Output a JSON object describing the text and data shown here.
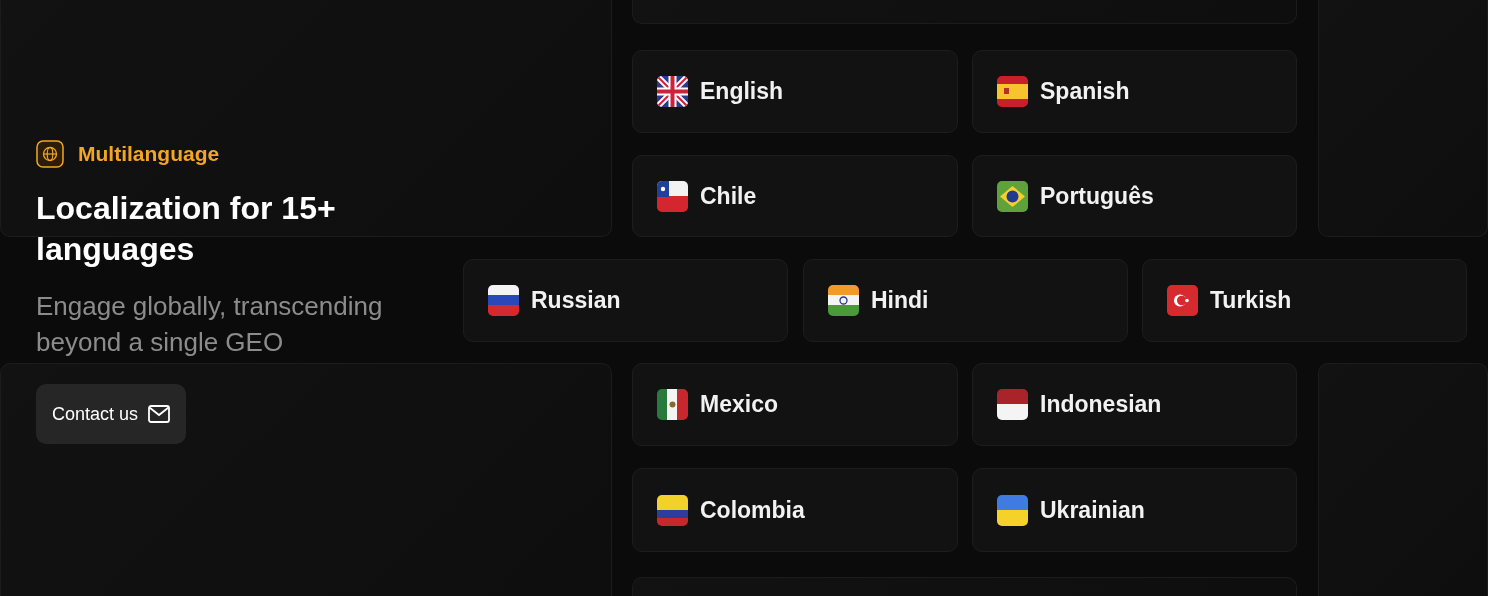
{
  "feature": {
    "tag": "Multilanguage",
    "title": "Localization for 15+ languages",
    "subtitle": "Engage globally, transcending beyond a single GEO",
    "button": "Contact us"
  },
  "languages": [
    {
      "label": "English"
    },
    {
      "label": "Spanish"
    },
    {
      "label": "Chile"
    },
    {
      "label": "Português"
    },
    {
      "label": "Russian"
    },
    {
      "label": "Hindi"
    },
    {
      "label": "Turkish"
    },
    {
      "label": "Mexico"
    },
    {
      "label": "Indonesian"
    },
    {
      "label": "Colombia"
    },
    {
      "label": "Ukrainian"
    }
  ]
}
